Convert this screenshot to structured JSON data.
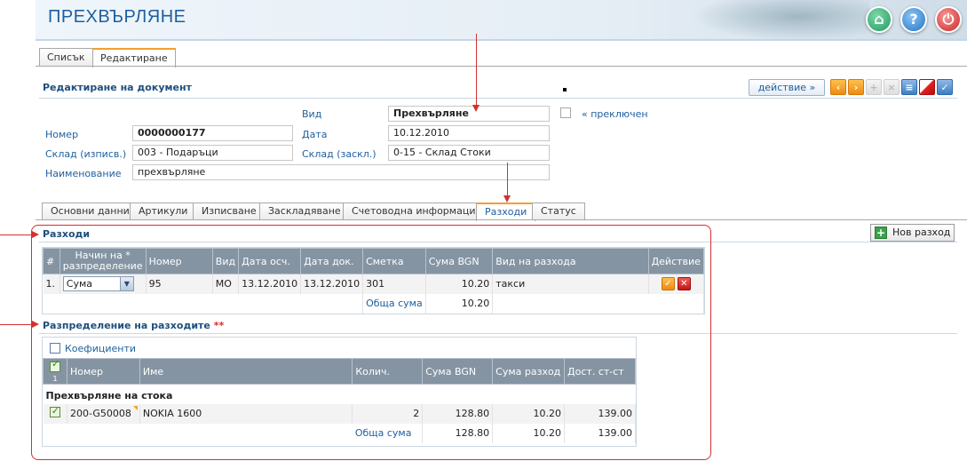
{
  "header": {
    "title": "ПРЕХВЪРЛЯНЕ",
    "buttons": [
      "home-icon",
      "help-icon",
      "power-icon"
    ]
  },
  "top_tabs": [
    {
      "label": "Списък"
    },
    {
      "label": "Редактиране",
      "active": true
    }
  ],
  "edit_section": {
    "title": "Редактиране на документ"
  },
  "toolbar": {
    "action_label": "действие »",
    "icons": [
      "prev-icon",
      "next-icon",
      "add-icon",
      "delete-icon",
      "list-icon",
      "cancel-icon",
      "confirm-icon"
    ]
  },
  "form": {
    "vid_label": "Вид",
    "vid_value": "Прехвърляне",
    "switched_label": "« преключен",
    "number_label": "Номер",
    "number_value": "0000000177",
    "date_label": "Дата",
    "date_value": "10.12.2010",
    "warehouse_out_label": "Склад (изписв.)",
    "warehouse_out_value": "003 - Подаръци",
    "warehouse_in_label": "Склад (заскл.)",
    "warehouse_in_value": "0-15 - Склад Стоки",
    "name_label": "Наименование",
    "name_value": "прехвърляне"
  },
  "sub_tabs": [
    {
      "label": "Основни данни"
    },
    {
      "label": "Артикули"
    },
    {
      "label": "Изписване"
    },
    {
      "label": "Заскладяване"
    },
    {
      "label": "Счетоводна информация"
    },
    {
      "label": "Разходи",
      "active": true
    },
    {
      "label": "Статус"
    }
  ],
  "expenses": {
    "title": "Разходи",
    "new_button": "Нов разход",
    "columns": [
      "#",
      "Начин на *\nразпределение",
      "Номер",
      "Вид",
      "Дата осч.",
      "Дата док.",
      "Сметка",
      "Сума BGN",
      "Вид на разхода",
      "Действие"
    ],
    "rows": [
      {
        "idx": "1.",
        "method": "Сума",
        "number": "95",
        "type": "МО",
        "date_acc": "13.12.2010",
        "date_doc": "13.12.2010",
        "account": "301",
        "amount": "10.20",
        "expense_type": "такси"
      }
    ],
    "total_label": "Обща сума",
    "total_value": "10.20"
  },
  "distribution": {
    "title": "Разпределение на разходите",
    "title_mark": "**",
    "coef_label": "Коефициенти",
    "header_check_count": "1",
    "columns": [
      "Номер",
      "Име",
      "Колич.",
      "Сума BGN",
      "Сума разход",
      "Дост. ст-ст"
    ],
    "group_label": "Прехвърляне на стока",
    "rows": [
      {
        "number": "200-G50008",
        "name": "NOKIA 1600",
        "qty": "2",
        "amount": "128.80",
        "expense": "10.20",
        "cost": "139.00"
      }
    ],
    "total_label": "Обща сума",
    "totals": {
      "amount": "128.80",
      "expense": "10.20",
      "cost": "139.00"
    }
  },
  "colors": {
    "accent": "#1e5f9e",
    "tab_active": "#f0a030",
    "header_th": "#8494a3",
    "annotation": "#d43030"
  }
}
